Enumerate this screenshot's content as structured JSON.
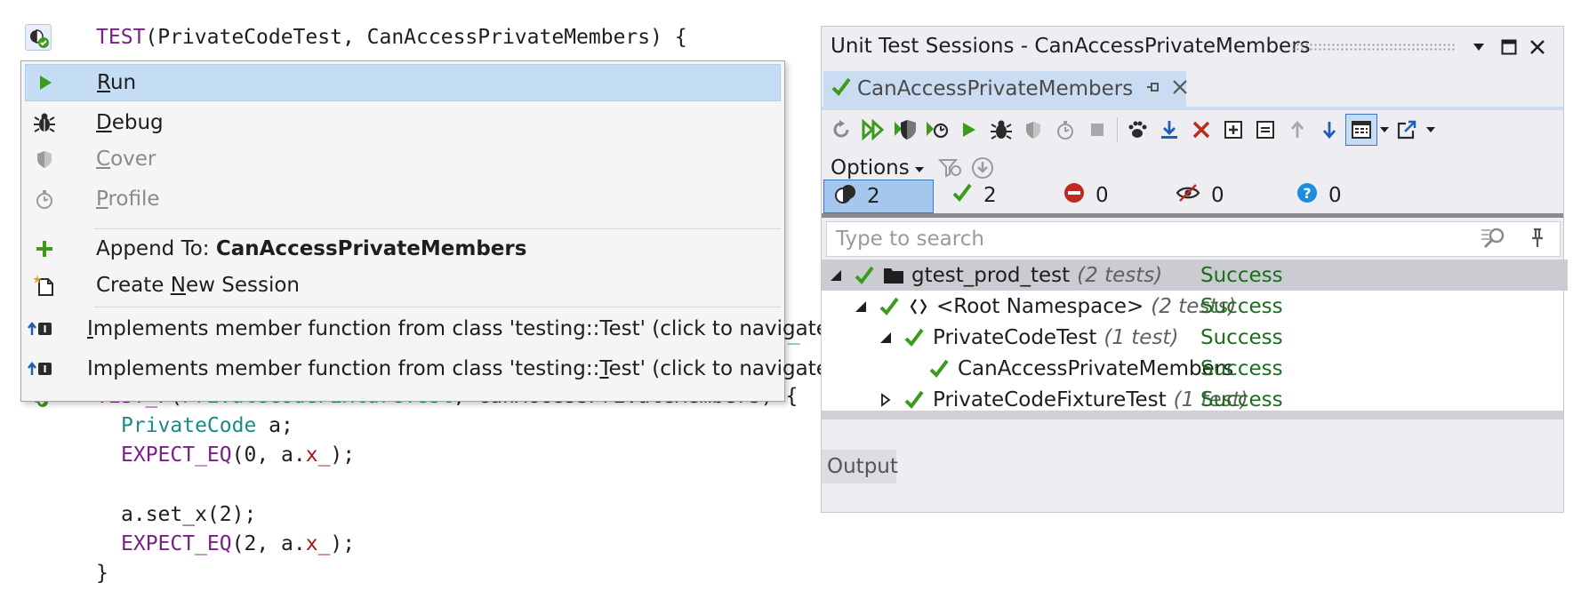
{
  "editor": {
    "line1": {
      "kw": "TEST",
      "rest": "(PrivateCodeTest, CanAccessPrivateMembers) {"
    },
    "peek_fragment": "ST_",
    "line2": {
      "kw": "TEST_F",
      "args_teal": "PrivateCodeFixtureTest",
      "rest": ", CanAccessPrivateMembers) {"
    },
    "line3": {
      "type": "PrivateCode",
      "rest": " a;"
    },
    "line4": {
      "macro": "EXPECT_EQ",
      "pre": "(0, a.",
      "member": "x_",
      "post": ");"
    },
    "line5": {
      "text": "a.set_x(2);"
    },
    "line6": {
      "macro": "EXPECT_EQ",
      "pre": "(2, a.",
      "member": "x_",
      "post": ");"
    },
    "line7": {
      "text": "}"
    }
  },
  "context_menu": {
    "items": [
      {
        "key": "R",
        "rest": "un",
        "icon": "run-icon"
      },
      {
        "key": "D",
        "rest": "ebug",
        "icon": "debug-icon"
      },
      {
        "key": "C",
        "rest": "over",
        "icon": "cover-icon"
      },
      {
        "key": "P",
        "rest": "rofile",
        "icon": "profile-icon"
      }
    ],
    "append_prefix": "Append To: ",
    "append_target": "CanAccessPrivateMembers",
    "create_pre": "Create ",
    "create_key": "N",
    "create_post": "ew Session",
    "impl1_key": "I",
    "impl1_rest": "mplements member function from class 'testing::Test' (click to navigate)",
    "impl2_pre": "Implements member function from class 'testing::",
    "impl2_key": "T",
    "impl2_post": "est' (click to navigate)"
  },
  "unit_test_sessions": {
    "title": "Unit Test Sessions - CanAccessPrivateMembers",
    "tab_label": "CanAccessPrivateMembers",
    "options_label": "Options",
    "counters": {
      "total": "2",
      "passed": "2",
      "failed": "0",
      "ignored": "0",
      "unknown": "0"
    },
    "search_placeholder": "Type to search",
    "tree": [
      {
        "name": "gtest_prod_test",
        "count": "(2 tests)",
        "status": "Success"
      },
      {
        "name": "<Root Namespace>",
        "count": "(2 tests)",
        "status": "Success"
      },
      {
        "name": "PrivateCodeTest",
        "count": "(1 test)",
        "status": "Success"
      },
      {
        "name": "CanAccessPrivateMembers",
        "count": "",
        "status": "Success"
      },
      {
        "name": "PrivateCodeFixtureTest",
        "count": "(1 test)",
        "status": "Success"
      }
    ],
    "output_tab": "Output"
  },
  "colors": {
    "success_text": "#1b6e1b",
    "check_green": "#3c9a1c",
    "accent_blue": "#1e5fb4",
    "selection": "#c5dcf5"
  }
}
